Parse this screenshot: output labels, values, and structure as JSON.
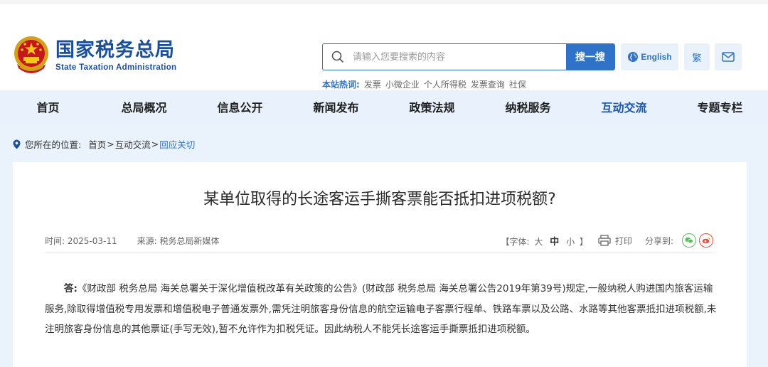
{
  "header": {
    "site_name_cn": "国家税务总局",
    "site_name_en": "State Taxation Administration",
    "search": {
      "placeholder": "请输入您要搜索的内容",
      "button_label": "搜一搜"
    },
    "hot_label": "本站热词:",
    "hot_words": [
      "发票",
      "小微企业",
      "个人所得税",
      "发票查询",
      "社保"
    ],
    "lang_english": "English",
    "lang_traditional": "繁"
  },
  "nav": {
    "items": [
      {
        "label": "首页"
      },
      {
        "label": "总局概况"
      },
      {
        "label": "信息公开"
      },
      {
        "label": "新闻发布"
      },
      {
        "label": "政策法规"
      },
      {
        "label": "纳税服务"
      },
      {
        "label": "互动交流"
      },
      {
        "label": "专题专栏"
      }
    ],
    "active_index": 6
  },
  "breadcrumb": {
    "prefix": "您所在的位置:",
    "items": [
      "首页",
      "互动交流",
      "回应关切"
    ],
    "separator": ">"
  },
  "article": {
    "title": "某单位取得的长途客运手撕客票能否抵扣进项税额?",
    "time_label": "时间:",
    "time_value": "2025-03-11",
    "source_label": "来源:",
    "source_value": "税务总局新媒体",
    "font_prefix": "【字体:",
    "font_large": "大",
    "font_medium": "中",
    "font_small": "小",
    "font_suffix": "】",
    "print_label": "打印",
    "share_label": "分享到:",
    "answer_label": "答:",
    "answer_text": "《财政部 税务总局 海关总署关于深化增值税改革有关政策的公告》(财政部 税务总局 海关总署公告2019年第39号)规定,一般纳税人购进国内旅客运输服务,除取得增值税专用发票和增值税电子普通发票外,需凭注明旅客身份信息的航空运输电子客票行程单、铁路车票以及公路、水路等其他客票抵扣进项税额,未注明旅客身份信息的其他票证(手写无效),暂不允许作为扣税凭证。因此纳税人不能凭长途客运手撕票抵扣进项税额。"
  },
  "colors": {
    "brand_blue": "#1a4f9c",
    "accent_blue": "#2f73c8",
    "nav_bg": "#e8f1fc",
    "page_bg": "#eaf2fc"
  },
  "icons": {
    "emblem": "national-emblem-icon",
    "search": "search-icon",
    "globe": "globe-icon",
    "mail": "mail-icon",
    "pin": "location-pin-icon",
    "print": "printer-icon",
    "wechat": "wechat-icon",
    "weibo": "weibo-icon"
  }
}
